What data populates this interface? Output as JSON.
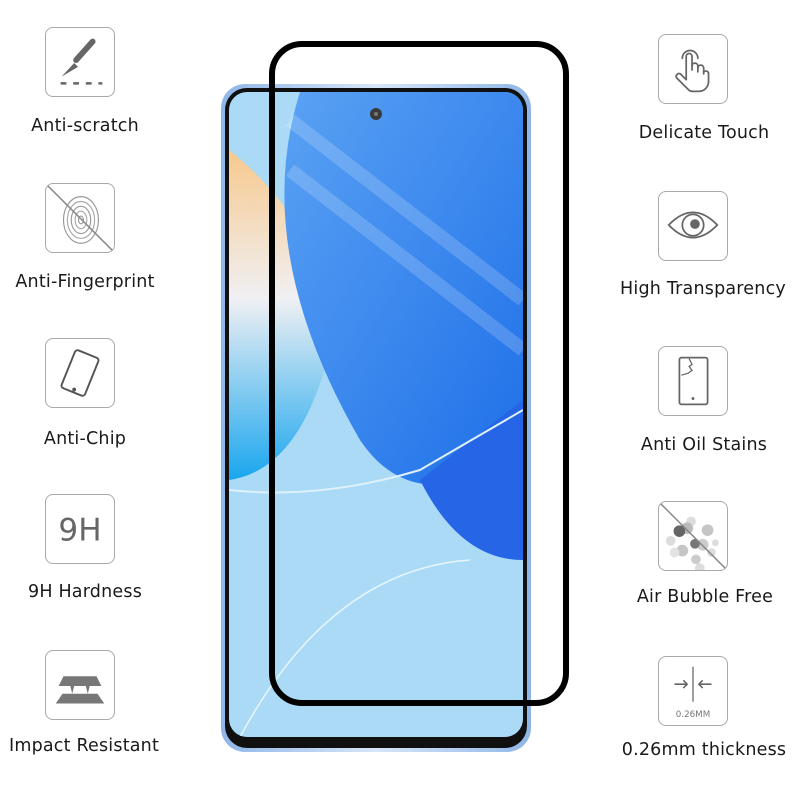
{
  "left_features": [
    {
      "label": "Anti-scratch",
      "icon": "scalpel-scratch-icon"
    },
    {
      "label": "Anti-Fingerprint",
      "icon": "fingerprint-crossed-icon"
    },
    {
      "label": "Anti-Chip",
      "icon": "tilted-phone-icon"
    },
    {
      "label": "9H Hardness",
      "icon": "9h-icon",
      "icon_text": "9H"
    },
    {
      "label": "Impact Resistant",
      "icon": "layered-plates-icon"
    }
  ],
  "right_features": [
    {
      "label": "Delicate Touch",
      "icon": "touch-hand-icon"
    },
    {
      "label": "High Transparency",
      "icon": "eye-icon"
    },
    {
      "label": "Anti Oil Stains",
      "icon": "cracked-phone-icon"
    },
    {
      "label": "Air Bubble Free",
      "icon": "bubbles-crossed-icon"
    },
    {
      "label": "0.26mm thickness",
      "icon": "thickness-arrows-icon",
      "icon_text": "0.26MM"
    }
  ],
  "colors": {
    "icon_gray": "#6b6b6b",
    "border_gray": "#a9a9a9",
    "screen_blue": "#2f7df0",
    "screen_light_blue": "#a8d8f5",
    "film_black": "#000000"
  }
}
